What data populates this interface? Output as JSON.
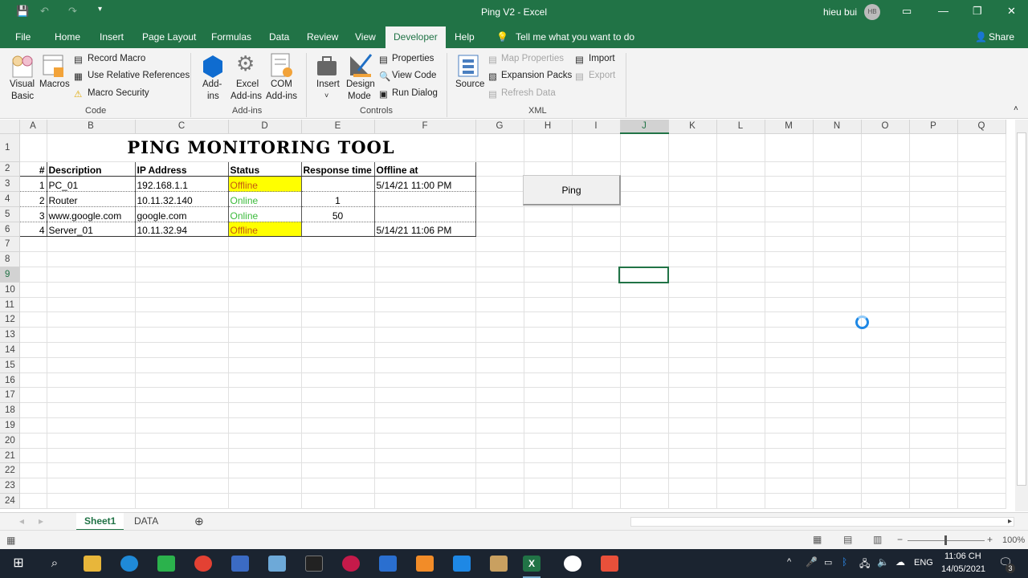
{
  "window": {
    "title": "Ping V2  -  Excel",
    "user": "hieu bui",
    "initials": "HB"
  },
  "menu": {
    "tabs": [
      "File",
      "Home",
      "Insert",
      "Page Layout",
      "Formulas",
      "Data",
      "Review",
      "View",
      "Developer",
      "Help"
    ],
    "active": "Developer",
    "tell_me": "Tell me what you want to do",
    "share": "Share"
  },
  "ribbon": {
    "code": {
      "label": "Code",
      "visual_basic_1": "Visual",
      "visual_basic_2": "Basic",
      "macros": "Macros",
      "record_macro": "Record Macro",
      "relative_refs": "Use Relative References",
      "macro_security": "Macro Security"
    },
    "addins": {
      "label": "Add-ins",
      "addins_1": "Add-",
      "addins_2": "ins",
      "excel_1": "Excel",
      "excel_2": "Add-ins",
      "com_1": "COM",
      "com_2": "Add-ins"
    },
    "controls": {
      "label": "Controls",
      "insert": "Insert",
      "design_1": "Design",
      "design_2": "Mode",
      "properties": "Properties",
      "view_code": "View Code",
      "run_dialog": "Run Dialog"
    },
    "xml": {
      "label": "XML",
      "source": "Source",
      "map_properties": "Map Properties",
      "expansion_packs": "Expansion Packs",
      "refresh_data": "Refresh Data",
      "import": "Import",
      "export": "Export"
    }
  },
  "sheet": {
    "columns": [
      "A",
      "B",
      "C",
      "D",
      "E",
      "F",
      "G",
      "H",
      "I",
      "J",
      "K",
      "L",
      "M",
      "N",
      "O",
      "P",
      "Q"
    ],
    "selected_column": "J",
    "selected_cell": "J9",
    "title": "PING MONITORING TOOL",
    "headers": [
      "#",
      "Description",
      "IP Address",
      "Status",
      "Response time",
      "Offline at"
    ],
    "rows": [
      {
        "num": "1",
        "desc": "PC_01",
        "ip": "192.168.1.1",
        "status": "Offline",
        "resp": "",
        "offline": "5/14/21 11:00 PM"
      },
      {
        "num": "2",
        "desc": "Router",
        "ip": "10.11.32.140",
        "status": "Online",
        "resp": "1",
        "offline": ""
      },
      {
        "num": "3",
        "desc": "www.google.com",
        "ip": "google.com",
        "status": "Online",
        "resp": "50",
        "offline": ""
      },
      {
        "num": "4",
        "desc": "Server_01",
        "ip": "10.11.32.94",
        "status": "Offline",
        "resp": "",
        "offline": "5/14/21 11:06 PM"
      }
    ],
    "ping_button": "Ping",
    "row_count": 24
  },
  "sheet_tabs": {
    "tabs": [
      "Sheet1",
      "DATA"
    ],
    "active": "Sheet1"
  },
  "status_bar": {
    "zoom": "100%"
  },
  "taskbar": {
    "language": "ENG",
    "time": "11:06 CH",
    "date": "14/05/2021",
    "notifications": "3"
  },
  "colors": {
    "excel_green": "#217346",
    "offline_fill": "#ffff00",
    "offline_text": "#c55a11",
    "online_text": "#3dbb3d"
  }
}
